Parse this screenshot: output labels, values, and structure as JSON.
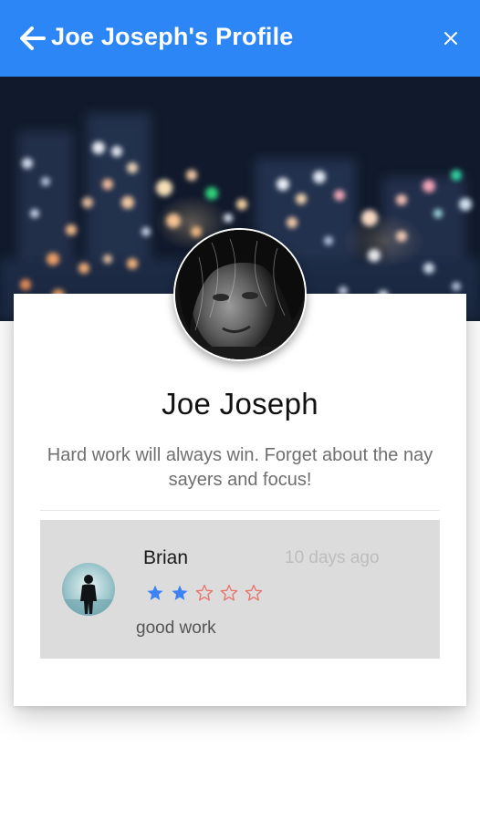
{
  "header": {
    "title": "Joe Joseph's Profile",
    "back_icon": "arrow-left-icon",
    "close_icon": "close-icon",
    "background_color": "#2d86f5"
  },
  "profile": {
    "name": "Joe Joseph",
    "bio": "Hard work will always win. Forget about the nay sayers and focus!",
    "cover_image": "night-city-bokeh",
    "avatar_image": "man-portrait-bw"
  },
  "review": {
    "reviewer_name": "Brian",
    "date": "10 days ago",
    "rating": 2,
    "max_rating": 5,
    "text": "good work",
    "avatar_image": "silhouette-portrait",
    "filled_star_color": "#3d82f2",
    "empty_star_color": "#e8736c"
  }
}
